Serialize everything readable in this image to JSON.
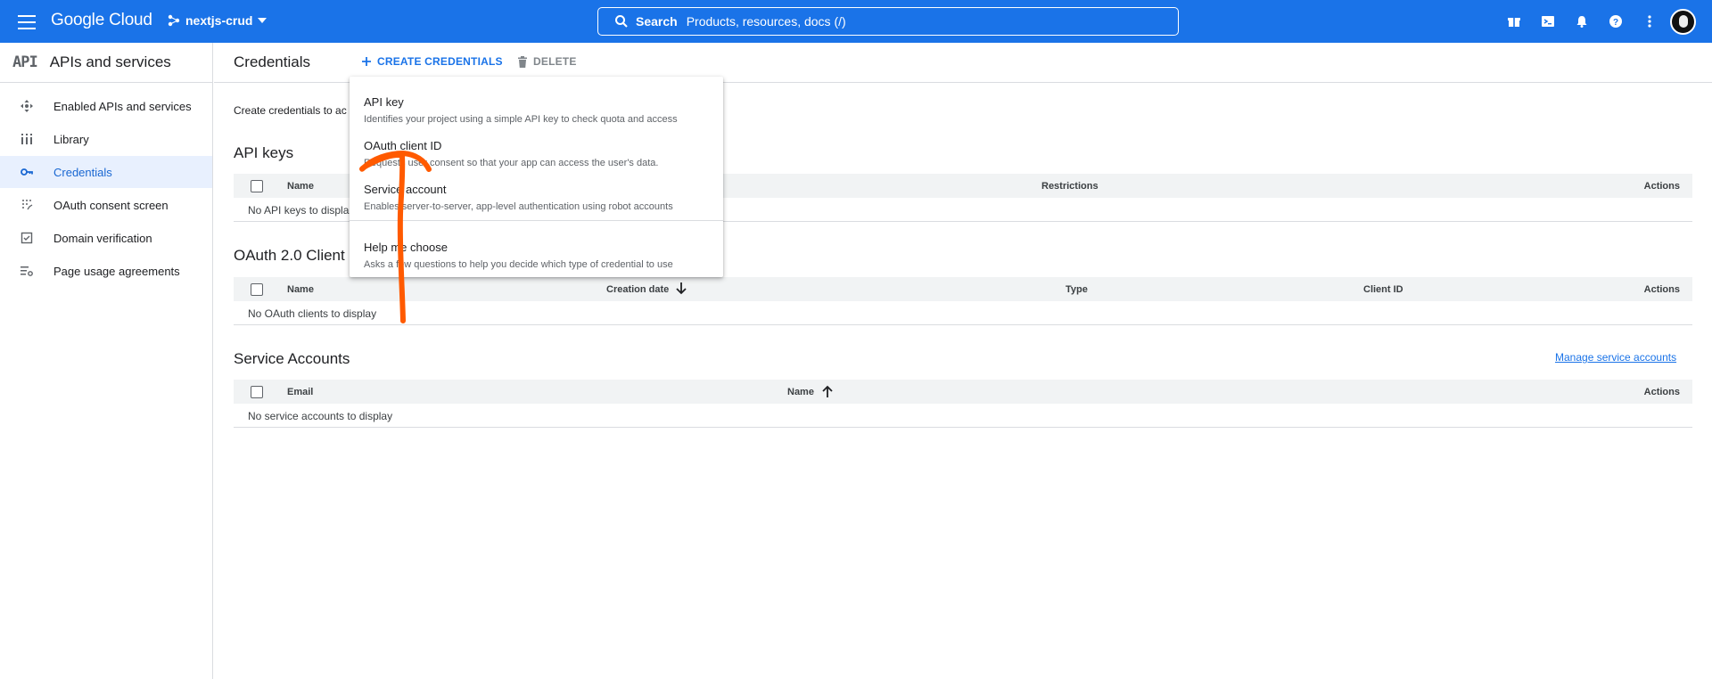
{
  "topbar": {
    "logo": "Google Cloud",
    "project": "nextjs-crud",
    "search_label": "Search",
    "search_placeholder": "Products, resources, docs (/)"
  },
  "sidebar": {
    "logo": "API",
    "title": "APIs and services",
    "items": [
      {
        "label": "Enabled APIs and services",
        "icon": "move-icon"
      },
      {
        "label": "Library",
        "icon": "library-icon"
      },
      {
        "label": "Credentials",
        "icon": "key-icon",
        "active": true
      },
      {
        "label": "OAuth consent screen",
        "icon": "consent-icon"
      },
      {
        "label": "Domain verification",
        "icon": "checkbox-icon"
      },
      {
        "label": "Page usage agreements",
        "icon": "settings-list-icon"
      }
    ]
  },
  "pagebar": {
    "title": "Credentials",
    "create_label": "CREATE CREDENTIALS",
    "delete_label": "DELETE"
  },
  "intro": "Create credentials to ac",
  "api_keys": {
    "title": "API keys",
    "columns": [
      "Name",
      "Restrictions",
      "Actions"
    ],
    "empty": "No API keys to displa"
  },
  "oauth": {
    "title": "OAuth 2.0 Client I",
    "columns": [
      "Name",
      "Creation date",
      "Type",
      "Client ID",
      "Actions"
    ],
    "empty": "No OAuth clients to display"
  },
  "service_accounts": {
    "title": "Service Accounts",
    "manage_link": "Manage service accounts",
    "columns": [
      "Email",
      "Name",
      "Actions"
    ],
    "empty": "No service accounts to display"
  },
  "dropdown": {
    "items": [
      {
        "title": "API key",
        "desc": "Identifies your project using a simple API key to check quota and access"
      },
      {
        "title": "OAuth client ID",
        "desc": "Requests user consent so that your app can access the user's data."
      },
      {
        "title": "Service account",
        "desc": "Enables server-to-server, app-level authentication using robot accounts"
      },
      {
        "title": "Help me choose",
        "desc": "Asks a few questions to help you decide which type of credential to use"
      }
    ]
  },
  "colors": {
    "brand": "#1a73e8",
    "active_bg": "#e8f0fe",
    "annotation": "#ff5a00"
  }
}
